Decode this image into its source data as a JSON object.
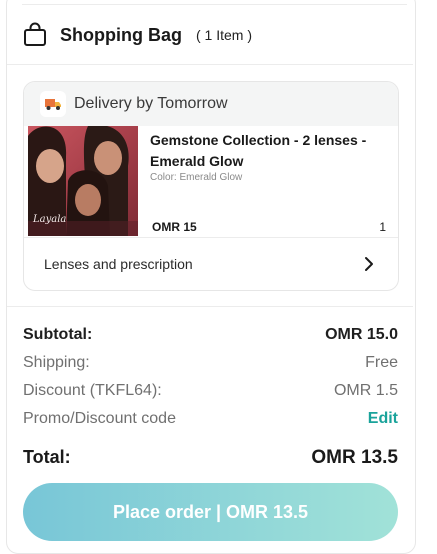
{
  "bag": {
    "title": "Shopping Bag",
    "item_count": "( 1 Item )",
    "icon": "shopping-bag-icon"
  },
  "delivery": {
    "text": "Delivery by Tomorrow",
    "icon": "delivery-truck-icon"
  },
  "product": {
    "name": "Gemstone Collection - 2 lenses - Emerald Glow",
    "color": "Color: Emerald Glow",
    "price": "OMR 15",
    "quantity": "1",
    "image_logo_text": "Layala"
  },
  "prescription": {
    "label": "Lenses and prescription",
    "icon": "chevron-right-icon"
  },
  "summary": {
    "subtotal_label": "Subtotal:",
    "subtotal_value": "OMR 15.0",
    "shipping_label": "Shipping:",
    "shipping_value": "Free",
    "discount_label": "Discount (TKFL64):",
    "discount_value": "OMR 1.5",
    "promo_label": "Promo/Discount code",
    "promo_action": "Edit",
    "total_label": "Total:",
    "total_value": "OMR 13.5"
  },
  "checkout": {
    "button_label": "Place order | OMR 13.5"
  },
  "colors": {
    "accent": "#1aa39b",
    "button_gradient_start": "#78c6d7",
    "button_gradient_end": "#a1e2d8"
  }
}
